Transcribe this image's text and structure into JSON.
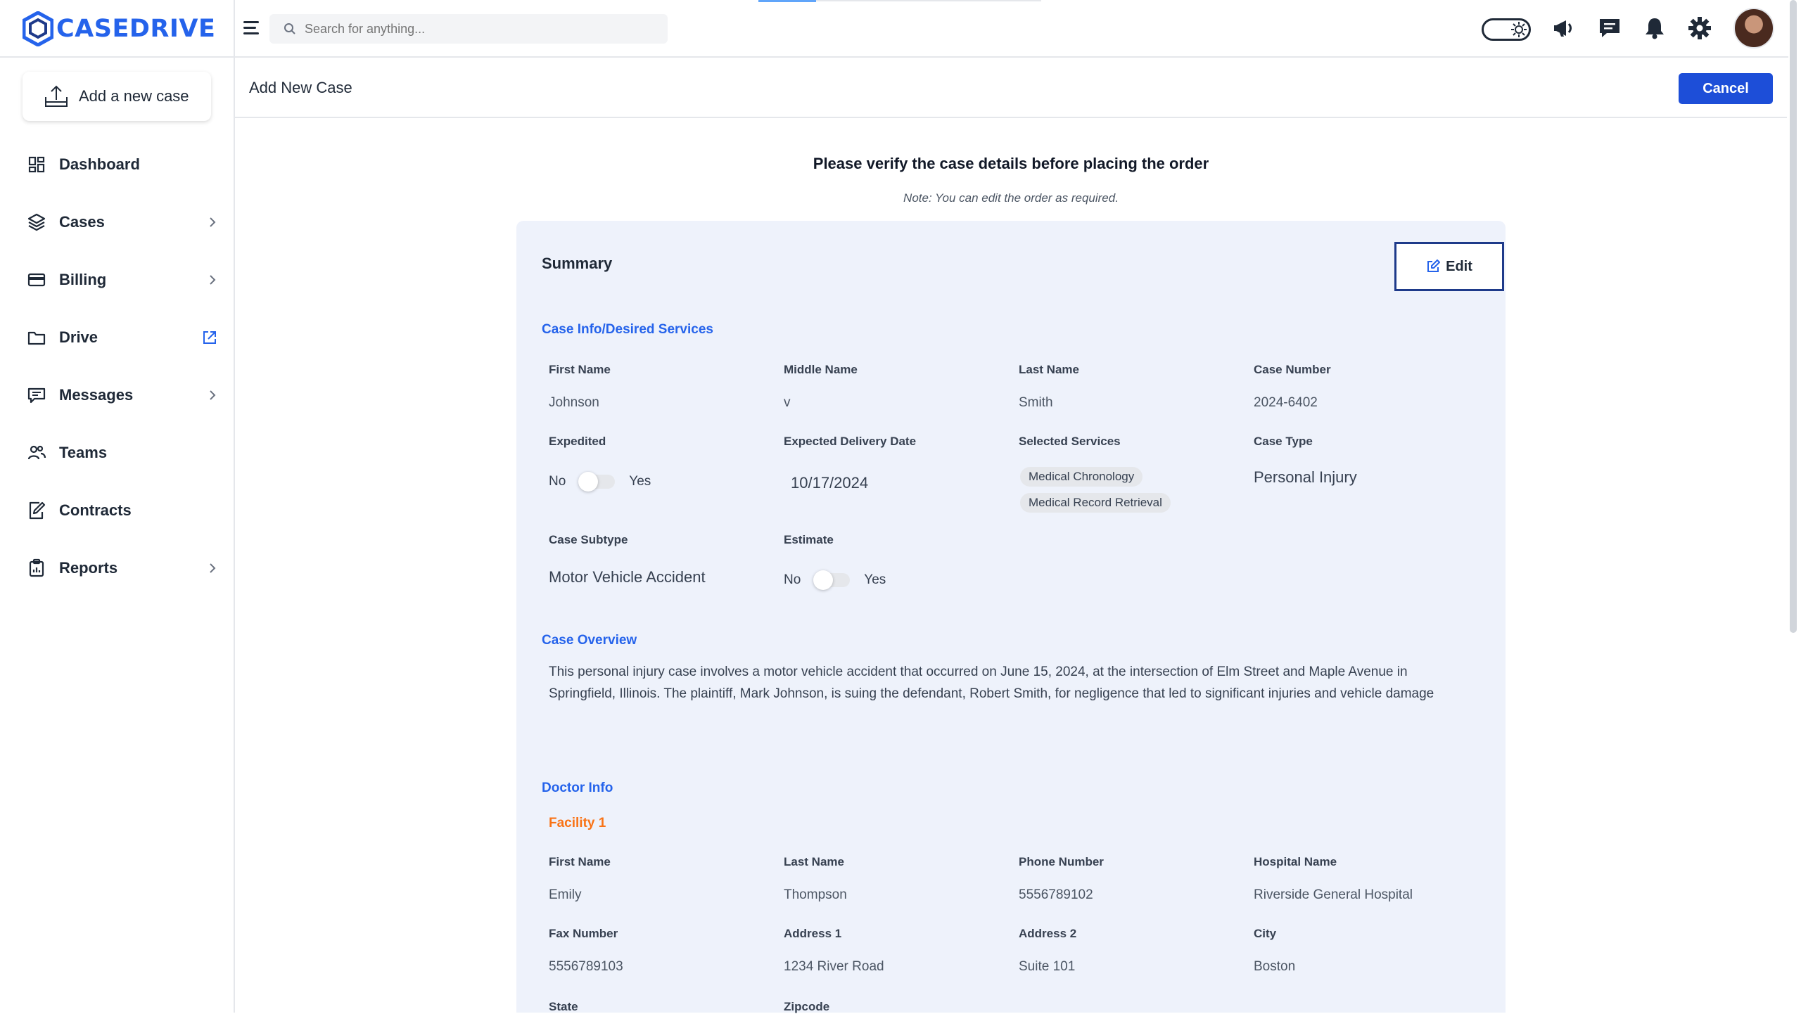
{
  "app": {
    "brand": "CASEDRIVE",
    "search_placeholder": "Search for anything..."
  },
  "sidebar": {
    "add_case_label": "Add a new case",
    "items": [
      {
        "label": "Dashboard",
        "icon": "dashboard-icon",
        "has_chevron": false
      },
      {
        "label": "Cases",
        "icon": "layers-icon",
        "has_chevron": true
      },
      {
        "label": "Billing",
        "icon": "credit-card-icon",
        "has_chevron": true
      },
      {
        "label": "Drive",
        "icon": "folder-icon",
        "has_chevron": false
      },
      {
        "label": "Messages",
        "icon": "message-icon",
        "has_chevron": true
      },
      {
        "label": "Teams",
        "icon": "users-icon",
        "has_chevron": false
      },
      {
        "label": "Contracts",
        "icon": "contract-icon",
        "has_chevron": false
      },
      {
        "label": "Reports",
        "icon": "clipboard-icon",
        "has_chevron": true
      }
    ]
  },
  "header": {
    "title": "Add New Case",
    "cancel_label": "Cancel"
  },
  "main": {
    "verify_title": "Please verify the case details before placing the order",
    "verify_note": "Note: You can edit the order as required.",
    "summary": {
      "title": "Summary",
      "edit_label": "Edit",
      "case_info": {
        "section_title": "Case Info/Desired Services",
        "first_name_label": "First Name",
        "first_name": "Johnson",
        "middle_name_label": "Middle Name",
        "middle_name": "v",
        "last_name_label": "Last Name",
        "last_name": "Smith",
        "case_number_label": "Case Number",
        "case_number": "2024-6402",
        "expedited_label": "Expedited",
        "expedited_no": "No",
        "expedited_yes": "Yes",
        "delivery_label": "Expected Delivery Date",
        "delivery_date": "10/17/2024",
        "services_label": "Selected Services",
        "services": [
          "Medical Chronology",
          "Medical Record Retrieval"
        ],
        "case_type_label": "Case Type",
        "case_type": "Personal Injury",
        "subtype_label": "Case Subtype",
        "subtype": "Motor Vehicle Accident",
        "estimate_label": "Estimate",
        "estimate_no": "No",
        "estimate_yes": "Yes"
      },
      "overview": {
        "section_title": "Case Overview",
        "text": "This personal injury case involves a motor vehicle accident that occurred on June 15, 2024, at the intersection of Elm Street and Maple Avenue in Springfield, Illinois. The plaintiff, Mark Johnson, is suing the defendant, Robert Smith, for negligence that led to significant injuries and vehicle damage"
      },
      "doctor": {
        "section_title": "Doctor Info",
        "facility_title": "Facility 1",
        "first_name_label": "First Name",
        "first_name": "Emily",
        "last_name_label": "Last Name",
        "last_name": "Thompson",
        "phone_label": "Phone Number",
        "phone": "5556789102",
        "hospital_label": "Hospital Name",
        "hospital": "Riverside General Hospital",
        "fax_label": "Fax Number",
        "fax": "5556789103",
        "address1_label": "Address 1",
        "address1": "1234 River Road",
        "address2_label": "Address 2",
        "address2": "Suite 101",
        "city_label": "City",
        "city": "Boston",
        "state_label": "State",
        "zipcode_label": "Zipcode"
      }
    }
  },
  "colors": {
    "accent": "#2563eb",
    "primary_button": "#1d4ed8",
    "card_bg": "#eef2fb",
    "facility_accent": "#f97316"
  }
}
